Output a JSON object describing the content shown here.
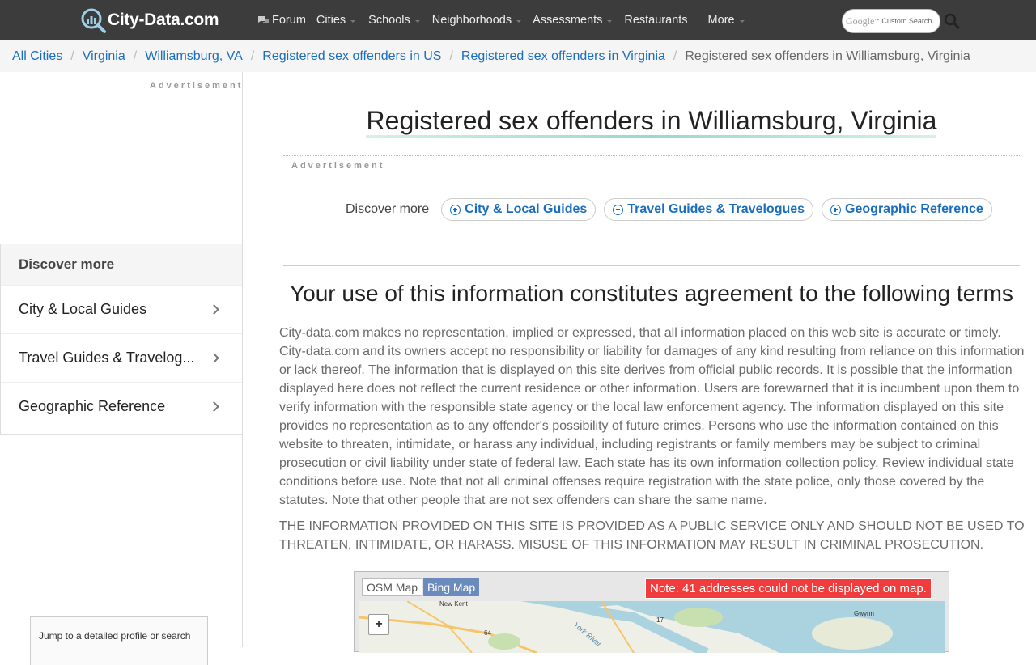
{
  "site": {
    "name": "City-Data.com"
  },
  "nav": {
    "items": [
      {
        "label": "Forum",
        "has_icon": true,
        "caret": false
      },
      {
        "label": "Cities",
        "caret": true
      },
      {
        "label": "Schools",
        "caret": true
      },
      {
        "label": "Neighborhoods",
        "caret": true
      },
      {
        "label": "Assessments",
        "caret": true
      },
      {
        "label": "Restaurants",
        "caret": false
      },
      {
        "label": "More",
        "caret": true
      }
    ],
    "search": {
      "brand": "Google",
      "tm": "™",
      "label": "Custom Search"
    }
  },
  "breadcrumb": [
    {
      "label": "All Cities"
    },
    {
      "label": "Virginia"
    },
    {
      "label": "Williamsburg, VA"
    },
    {
      "label": "Registered sex offenders in US"
    },
    {
      "label": "Registered sex offenders in Virginia"
    },
    {
      "label": "Registered sex offenders in Williamsburg, Virginia",
      "active": true
    }
  ],
  "sidebar": {
    "ad_label": "Advertisement",
    "discover_title": "Discover more",
    "discover_items": [
      "City & Local Guides",
      "Travel Guides & Travelog...",
      "Geographic Reference"
    ],
    "jump_text": "Jump to a detailed profile or search"
  },
  "main": {
    "title": "Registered sex offenders in Williamsburg, Virginia",
    "ad_label": "Advertisement",
    "discover_label": "Discover more",
    "discover_pills": [
      "City & Local Guides",
      "Travel Guides & Travelogues",
      "Geographic Reference"
    ],
    "terms_title": "Your use of this information constitutes agreement to the following terms",
    "terms_body": "City-data.com makes no representation, implied or expressed, that all information placed on this web site is accurate or timely. City-data.com and its owners accept no responsibility or liability for damages of any kind resulting from reliance on this information or lack thereof. The information that is displayed on this site derives from official public records. It is possible that the information displayed here does not reflect the current residence or other information. Users are forewarned that it is incumbent upon them to verify information with the responsible state agency or the local law enforcement agency. The information displayed on this site provides no representation as to any offender's possibility of future crimes. Persons who use the information contained on this website to threaten, intimidate, or harass any individual, including registrants or family members may be subject to criminal prosecution or civil liability under state of federal law. Each state has its own information collection policy. Review individual state conditions before use. Note that not all criminal offenses require registration with the state police, only those covered by the statutes. Note that other people that are not sex offenders can share the same name.",
    "terms_caps": "THE INFORMATION PROVIDED ON THIS SITE IS PROVIDED AS A PUBLIC SERVICE ONLY AND SHOULD NOT BE USED TO THREATEN, INTIMIDATE, OR HARASS. MISUSE OF THIS INFORMATION MAY RESULT IN CRIMINAL PROSECUTION."
  },
  "map": {
    "tabs": [
      "OSM Map",
      "Bing Map"
    ],
    "note": "Note: 41 addresses could not be displayed on map.",
    "zoom_in": "+",
    "labels": [
      "New Kent",
      "64",
      "17",
      "York River",
      "Gwynn"
    ]
  }
}
